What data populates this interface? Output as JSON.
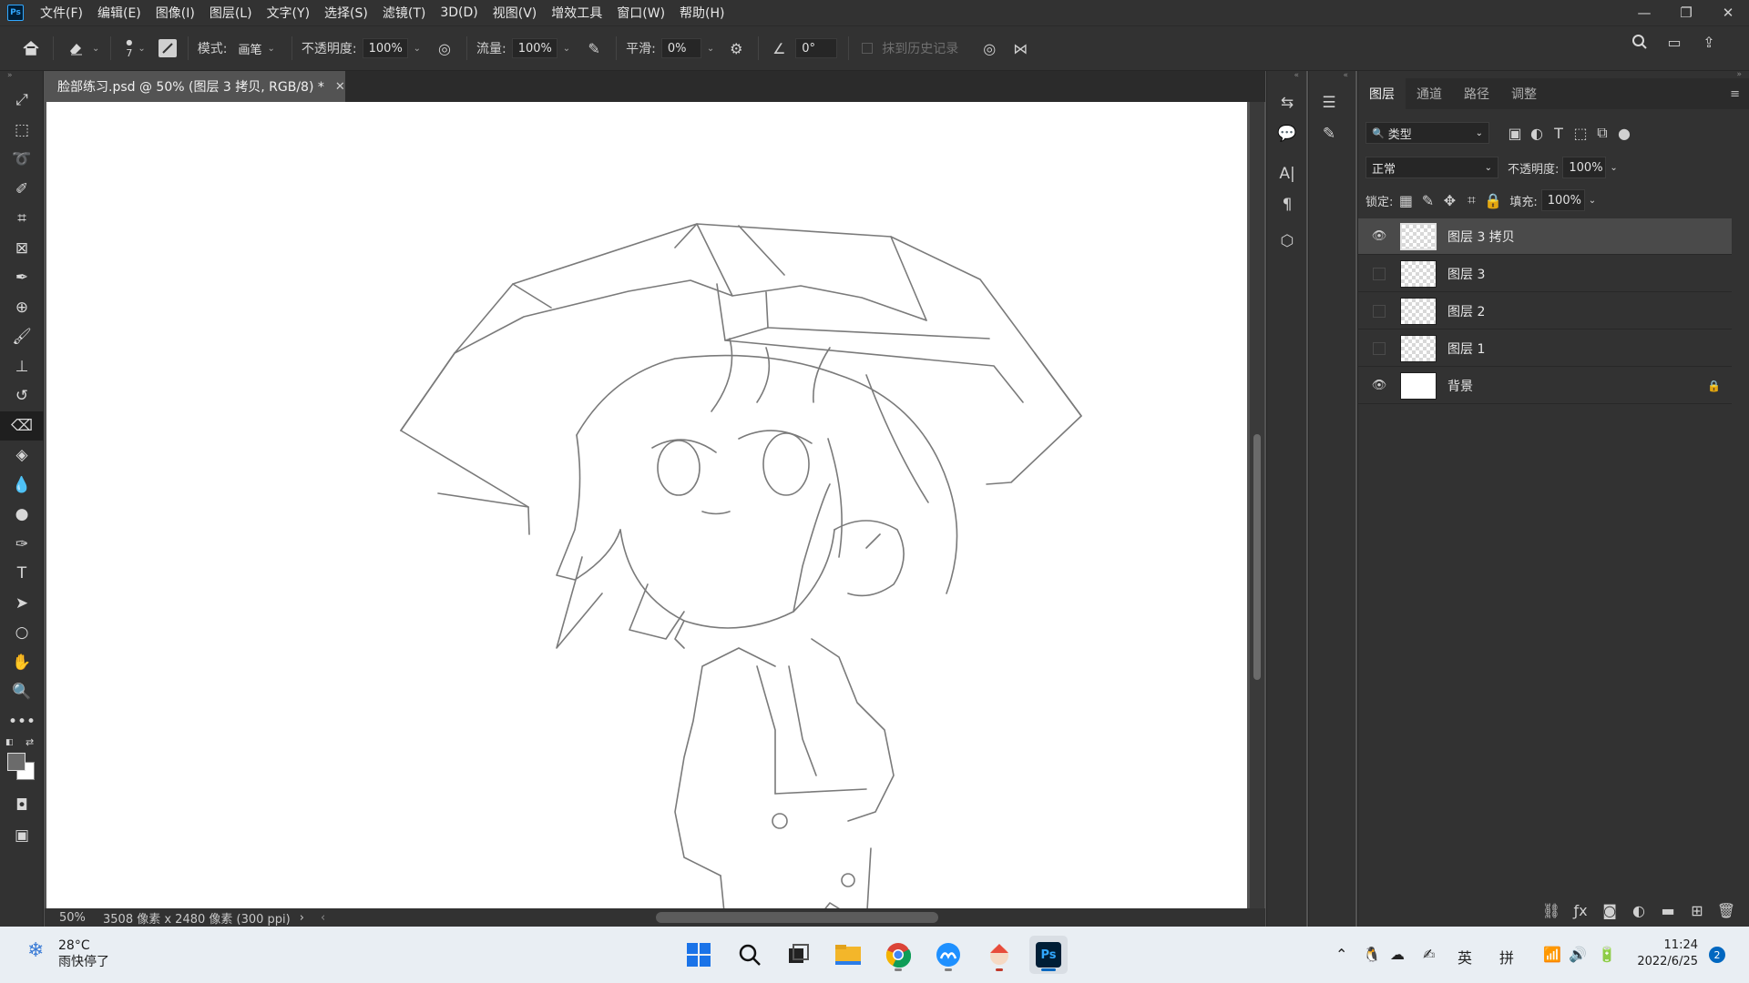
{
  "app": {
    "logo": "Ps"
  },
  "menu": [
    "文件(F)",
    "编辑(E)",
    "图像(I)",
    "图层(L)",
    "文字(Y)",
    "选择(S)",
    "滤镜(T)",
    "3D(D)",
    "视图(V)",
    "增效工具",
    "窗口(W)",
    "帮助(H)"
  ],
  "window_controls": {
    "minimize": "—",
    "restore": "❐",
    "close": "✕"
  },
  "options": {
    "brush_size": "7",
    "mode_label": "模式:",
    "mode_value": "画笔",
    "opacity_label": "不透明度:",
    "opacity_value": "100%",
    "flow_label": "流量:",
    "flow_value": "100%",
    "smooth_label": "平滑:",
    "smooth_value": "0%",
    "angle_value": "0°",
    "erase_history_label": "抹到历史记录"
  },
  "document": {
    "tab_title": "脸部练习.psd @ 50% (图层 3 拷贝, RGB/8) *",
    "zoom": "50%",
    "dimensions": "3508 像素 x 2480 像素 (300 ppi)"
  },
  "layers_panel": {
    "tabs": [
      "图层",
      "通道",
      "路径",
      "调整"
    ],
    "filter_label": "类型",
    "blend_mode": "正常",
    "opacity_label": "不透明度:",
    "opacity_value": "100%",
    "lock_label": "锁定:",
    "fill_label": "填充:",
    "fill_value": "100%",
    "layers": [
      {
        "name": "图层 3 拷贝",
        "visible": true,
        "selected": true,
        "type": "transparent"
      },
      {
        "name": "图层 3",
        "visible": false,
        "selected": false,
        "type": "transparent"
      },
      {
        "name": "图层 2",
        "visible": false,
        "selected": false,
        "type": "transparent"
      },
      {
        "name": "图层 1",
        "visible": false,
        "selected": false,
        "type": "transparent"
      },
      {
        "name": "背景",
        "visible": true,
        "selected": false,
        "type": "white",
        "locked": true
      }
    ]
  },
  "taskbar": {
    "weather_temp": "28°C",
    "weather_desc": "雨快停了",
    "lang": "英",
    "ime": "拼",
    "time": "11:24",
    "date": "2022/6/25",
    "notifications": "2"
  },
  "colors": {
    "accent": "#31a8ff",
    "panel": "#323232",
    "canvas_bg": "#535353"
  }
}
